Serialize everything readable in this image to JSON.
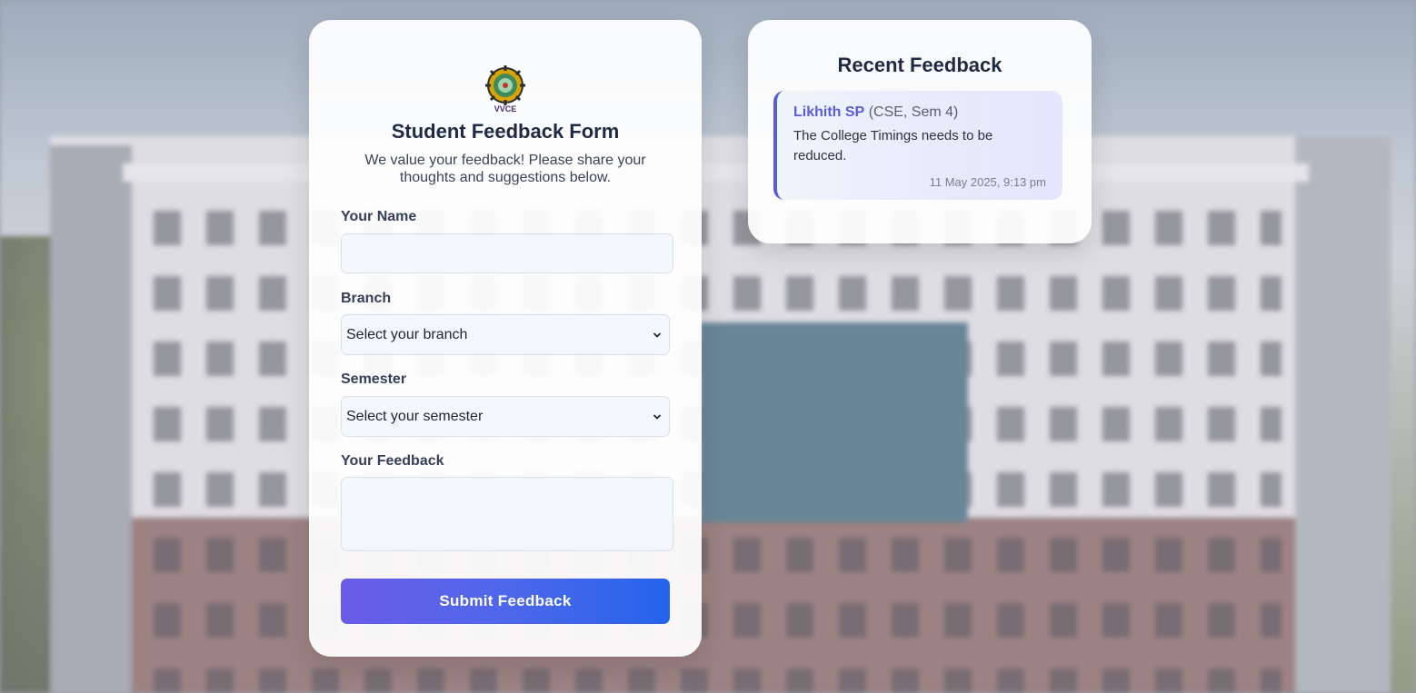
{
  "form": {
    "logo_text": "VVCE",
    "title": "Student Feedback Form",
    "subtitle": "We value your feedback! Please share your thoughts and suggestions below.",
    "name_label": "Your Name",
    "name_value": "",
    "branch_label": "Branch",
    "branch_selected": "Select your branch",
    "semester_label": "Semester",
    "semester_selected": "Select your semester",
    "feedback_label": "Your Feedback",
    "feedback_value": "",
    "submit_label": "Submit Feedback"
  },
  "recent": {
    "title": "Recent Feedback",
    "items": [
      {
        "name": "Likhith SP",
        "meta": "(CSE, Sem 4)",
        "text": "The College Timings needs to be reduced.",
        "time": "11 May 2025, 9:13 pm"
      }
    ]
  },
  "colors": {
    "accent": "#5b5bd6",
    "button_start": "#6b5ce7",
    "button_end": "#2563eb",
    "title_text": "#1f2a44"
  },
  "icons": [
    "college-logo",
    "chevron-down-icon"
  ]
}
